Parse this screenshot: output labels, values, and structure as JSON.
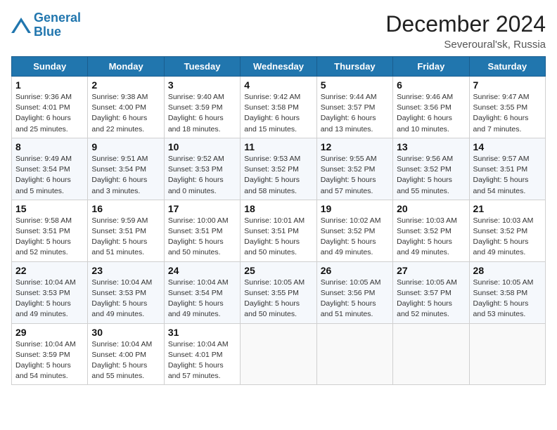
{
  "header": {
    "logo_line1": "General",
    "logo_line2": "Blue",
    "month_title": "December 2024",
    "location": "Severoural'sk, Russia"
  },
  "weekdays": [
    "Sunday",
    "Monday",
    "Tuesday",
    "Wednesday",
    "Thursday",
    "Friday",
    "Saturday"
  ],
  "weeks": [
    [
      {
        "day": 1,
        "info": "Sunrise: 9:36 AM\nSunset: 4:01 PM\nDaylight: 6 hours\nand 25 minutes."
      },
      {
        "day": 2,
        "info": "Sunrise: 9:38 AM\nSunset: 4:00 PM\nDaylight: 6 hours\nand 22 minutes."
      },
      {
        "day": 3,
        "info": "Sunrise: 9:40 AM\nSunset: 3:59 PM\nDaylight: 6 hours\nand 18 minutes."
      },
      {
        "day": 4,
        "info": "Sunrise: 9:42 AM\nSunset: 3:58 PM\nDaylight: 6 hours\nand 15 minutes."
      },
      {
        "day": 5,
        "info": "Sunrise: 9:44 AM\nSunset: 3:57 PM\nDaylight: 6 hours\nand 13 minutes."
      },
      {
        "day": 6,
        "info": "Sunrise: 9:46 AM\nSunset: 3:56 PM\nDaylight: 6 hours\nand 10 minutes."
      },
      {
        "day": 7,
        "info": "Sunrise: 9:47 AM\nSunset: 3:55 PM\nDaylight: 6 hours\nand 7 minutes."
      }
    ],
    [
      {
        "day": 8,
        "info": "Sunrise: 9:49 AM\nSunset: 3:54 PM\nDaylight: 6 hours\nand 5 minutes."
      },
      {
        "day": 9,
        "info": "Sunrise: 9:51 AM\nSunset: 3:54 PM\nDaylight: 6 hours\nand 3 minutes."
      },
      {
        "day": 10,
        "info": "Sunrise: 9:52 AM\nSunset: 3:53 PM\nDaylight: 6 hours\nand 0 minutes."
      },
      {
        "day": 11,
        "info": "Sunrise: 9:53 AM\nSunset: 3:52 PM\nDaylight: 5 hours\nand 58 minutes."
      },
      {
        "day": 12,
        "info": "Sunrise: 9:55 AM\nSunset: 3:52 PM\nDaylight: 5 hours\nand 57 minutes."
      },
      {
        "day": 13,
        "info": "Sunrise: 9:56 AM\nSunset: 3:52 PM\nDaylight: 5 hours\nand 55 minutes."
      },
      {
        "day": 14,
        "info": "Sunrise: 9:57 AM\nSunset: 3:51 PM\nDaylight: 5 hours\nand 54 minutes."
      }
    ],
    [
      {
        "day": 15,
        "info": "Sunrise: 9:58 AM\nSunset: 3:51 PM\nDaylight: 5 hours\nand 52 minutes."
      },
      {
        "day": 16,
        "info": "Sunrise: 9:59 AM\nSunset: 3:51 PM\nDaylight: 5 hours\nand 51 minutes."
      },
      {
        "day": 17,
        "info": "Sunrise: 10:00 AM\nSunset: 3:51 PM\nDaylight: 5 hours\nand 50 minutes."
      },
      {
        "day": 18,
        "info": "Sunrise: 10:01 AM\nSunset: 3:51 PM\nDaylight: 5 hours\nand 50 minutes."
      },
      {
        "day": 19,
        "info": "Sunrise: 10:02 AM\nSunset: 3:52 PM\nDaylight: 5 hours\nand 49 minutes."
      },
      {
        "day": 20,
        "info": "Sunrise: 10:03 AM\nSunset: 3:52 PM\nDaylight: 5 hours\nand 49 minutes."
      },
      {
        "day": 21,
        "info": "Sunrise: 10:03 AM\nSunset: 3:52 PM\nDaylight: 5 hours\nand 49 minutes."
      }
    ],
    [
      {
        "day": 22,
        "info": "Sunrise: 10:04 AM\nSunset: 3:53 PM\nDaylight: 5 hours\nand 49 minutes."
      },
      {
        "day": 23,
        "info": "Sunrise: 10:04 AM\nSunset: 3:53 PM\nDaylight: 5 hours\nand 49 minutes."
      },
      {
        "day": 24,
        "info": "Sunrise: 10:04 AM\nSunset: 3:54 PM\nDaylight: 5 hours\nand 49 minutes."
      },
      {
        "day": 25,
        "info": "Sunrise: 10:05 AM\nSunset: 3:55 PM\nDaylight: 5 hours\nand 50 minutes."
      },
      {
        "day": 26,
        "info": "Sunrise: 10:05 AM\nSunset: 3:56 PM\nDaylight: 5 hours\nand 51 minutes."
      },
      {
        "day": 27,
        "info": "Sunrise: 10:05 AM\nSunset: 3:57 PM\nDaylight: 5 hours\nand 52 minutes."
      },
      {
        "day": 28,
        "info": "Sunrise: 10:05 AM\nSunset: 3:58 PM\nDaylight: 5 hours\nand 53 minutes."
      }
    ],
    [
      {
        "day": 29,
        "info": "Sunrise: 10:04 AM\nSunset: 3:59 PM\nDaylight: 5 hours\nand 54 minutes."
      },
      {
        "day": 30,
        "info": "Sunrise: 10:04 AM\nSunset: 4:00 PM\nDaylight: 5 hours\nand 55 minutes."
      },
      {
        "day": 31,
        "info": "Sunrise: 10:04 AM\nSunset: 4:01 PM\nDaylight: 5 hours\nand 57 minutes."
      },
      null,
      null,
      null,
      null
    ]
  ]
}
